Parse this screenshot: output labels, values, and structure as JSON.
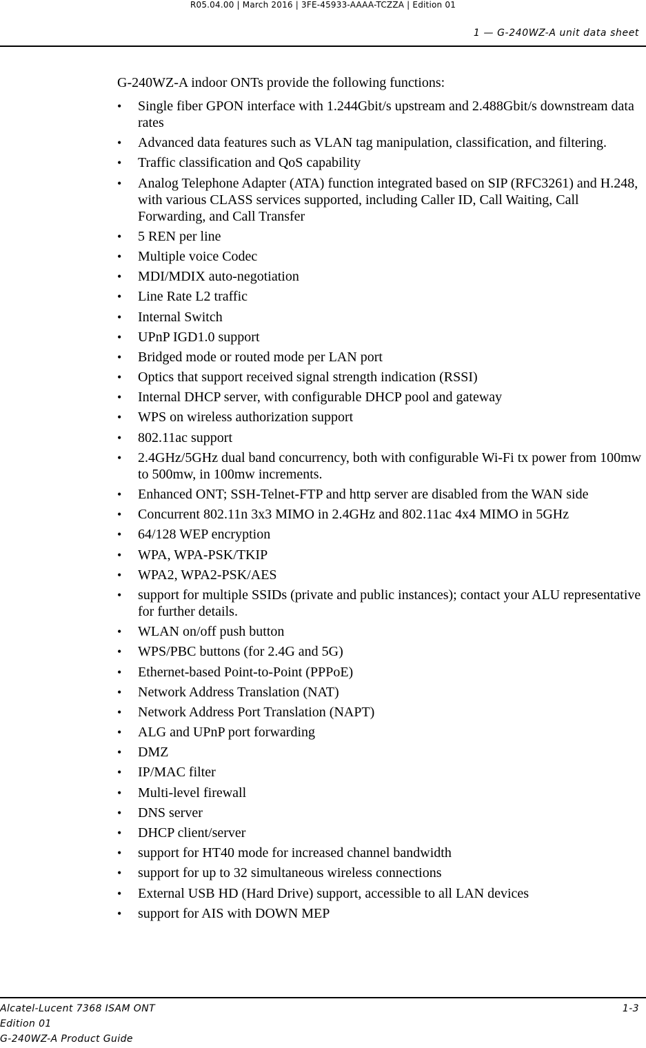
{
  "header": {
    "meta": "R05.04.00 | March 2016 | 3FE-45933-AAAA-TCZZA | Edition 01",
    "chapter": "1 — G-240WZ-A unit data sheet"
  },
  "content": {
    "intro": "G-240WZ-A indoor ONTs provide the following functions:",
    "bullet_glyph": "•",
    "items": [
      "Single fiber GPON interface with 1.244Gbit/s upstream and 2.488Gbit/s downstream data rates",
      "Advanced data features such as VLAN tag manipulation, classification, and filtering.",
      "Traffic classification and QoS capability",
      "Analog Telephone Adapter (ATA) function integrated based on SIP (RFC3261) and H.248, with various CLASS services supported, including Caller ID, Call Waiting, Call Forwarding, and Call Transfer",
      "5 REN per line",
      "Multiple voice Codec",
      "MDI/MDIX auto-negotiation",
      "Line Rate L2 traffic",
      "Internal Switch",
      "UPnP IGD1.0 support",
      "Bridged mode or routed mode per LAN port",
      "Optics that support received signal strength indication (RSSI)",
      "Internal DHCP server, with configurable DHCP pool and gateway",
      "WPS on wireless authorization support",
      "802.11ac support",
      "2.4GHz/5GHz dual band concurrency, both with configurable Wi-Fi tx power from 100mw to 500mw, in 100mw increments.",
      "Enhanced ONT; SSH-Telnet-FTP and http server are disabled from the WAN side",
      "Concurrent 802.11n 3x3 MIMO in 2.4GHz and 802.11ac 4x4 MIMO in 5GHz",
      "64/128 WEP encryption",
      "WPA, WPA-PSK/TKIP",
      "WPA2, WPA2-PSK/AES",
      "support for multiple SSIDs (private and public instances); contact your ALU representative for further details.",
      "WLAN on/off push button",
      "WPS/PBC buttons (for 2.4G and 5G)",
      "Ethernet-based Point-to-Point (PPPoE)",
      "Network Address Translation (NAT)",
      "Network Address Port Translation (NAPT)",
      "ALG and UPnP port forwarding",
      "DMZ",
      "IP/MAC filter",
      "Multi-level firewall",
      "DNS server",
      "DHCP client/server",
      "support for HT40 mode for increased channel bandwidth",
      "support for up to 32 simultaneous wireless connections",
      "External USB HD (Hard Drive) support, accessible to all LAN devices",
      "support for AIS with DOWN MEP"
    ]
  },
  "footer": {
    "product": "Alcatel-Lucent 7368 ISAM ONT",
    "edition": "Edition 01",
    "guide": "G-240WZ-A Product Guide",
    "page_number": "1-3"
  }
}
